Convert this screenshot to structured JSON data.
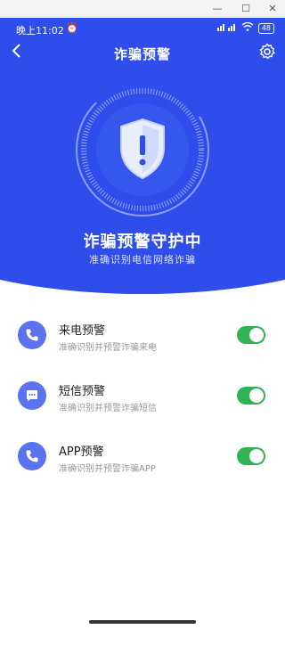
{
  "status_bar": {
    "time": "晚上11:02",
    "battery": "48"
  },
  "nav": {
    "title": "诈骗预警"
  },
  "hero": {
    "title": "诈骗预警守护中",
    "subtitle": "准确识别电信网络诈骗"
  },
  "items": [
    {
      "title": "来电预警",
      "desc": "准确识别并预警诈骗来电",
      "icon": "phone-icon",
      "enabled": true
    },
    {
      "title": "短信预警",
      "desc": "准确识别并预警诈骗短信",
      "icon": "sms-icon",
      "enabled": true
    },
    {
      "title": "APP预警",
      "desc": "准确识别并预警诈骗APP",
      "icon": "phone-icon",
      "enabled": true
    }
  ],
  "colors": {
    "primary": "#2e4dea",
    "toggle_on": "#2fb356",
    "icon_bg": "#5b73f0"
  }
}
